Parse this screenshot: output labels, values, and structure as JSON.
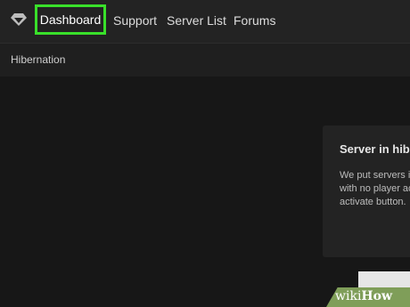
{
  "nav": {
    "logo_icon": "diamond-logo-icon",
    "items": [
      {
        "label": "Dashboard",
        "active": true
      },
      {
        "label": "Support"
      },
      {
        "label": "Server List"
      },
      {
        "label": "Forums"
      }
    ],
    "highlight_color": "#39e02a"
  },
  "subnav": {
    "breadcrumb": "Hibernation"
  },
  "card": {
    "title": "Server in hibe",
    "lines": [
      "We put servers i",
      "with no player ac",
      "activate button."
    ]
  },
  "watermark": {
    "part1": "wiki",
    "part2": "How"
  }
}
